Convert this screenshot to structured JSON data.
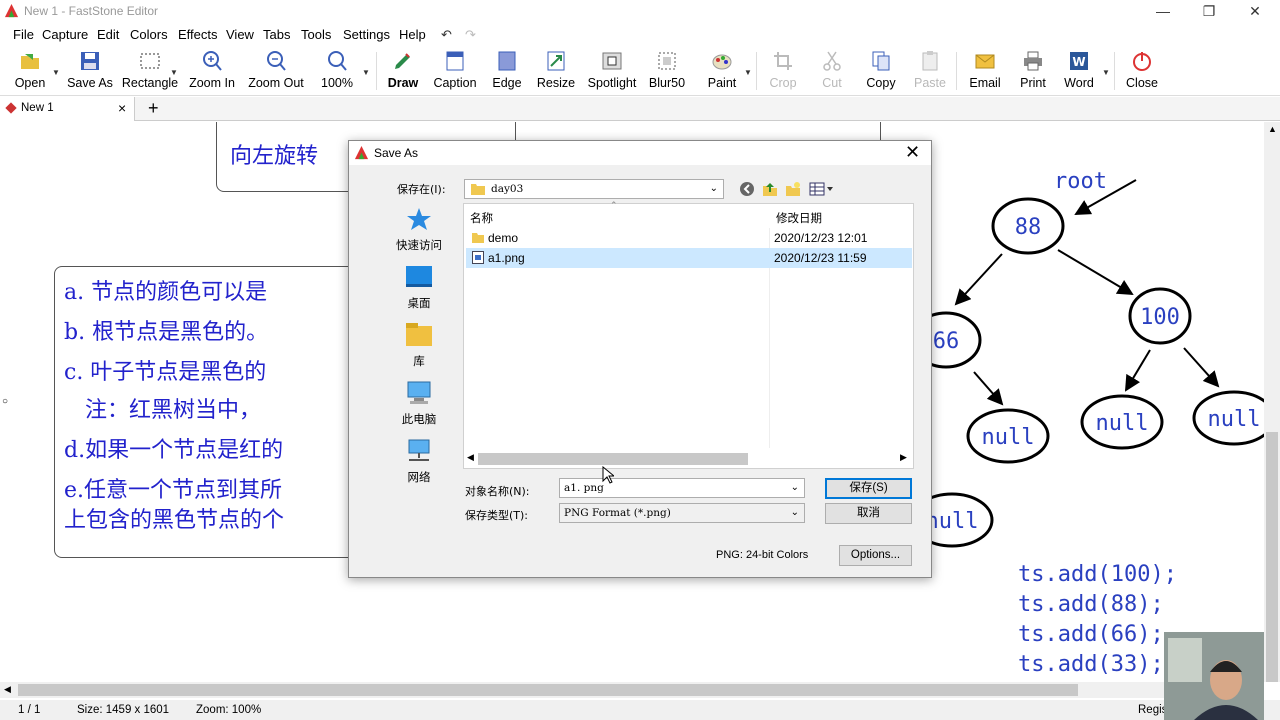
{
  "app": {
    "title": "New 1 - FastStone Editor"
  },
  "menu": [
    "File",
    "Capture",
    "Edit",
    "Colors",
    "Effects",
    "View",
    "Tabs",
    "Tools",
    "Settings",
    "Help"
  ],
  "toolbar": {
    "open": "Open",
    "save_as": "Save As",
    "rectangle": "Rectangle",
    "zoom_in": "Zoom In",
    "zoom_out": "Zoom Out",
    "zoom_level": "100%",
    "draw": "Draw",
    "caption": "Caption",
    "edge": "Edge",
    "resize": "Resize",
    "spotlight": "Spotlight",
    "blur": "Blur50",
    "paint": "Paint",
    "crop": "Crop",
    "cut": "Cut",
    "copy": "Copy",
    "paste": "Paste",
    "email": "Email",
    "print": "Print",
    "word": "Word",
    "close": "Close"
  },
  "tabs": {
    "active": "New 1",
    "close": "×",
    "add": "+"
  },
  "canvas": {
    "rotate_text": "向左旋转",
    "rules": [
      "a. 节点的颜色可以是",
      "b. 根节点是黑色的。",
      "c. 叶子节点是黑色的",
      "   注：红黑树当中，",
      "d.如果一个节点是红的",
      "e.任意一个节点到其所",
      "上包含的黑色节点的个"
    ],
    "tree": {
      "root_label": "root",
      "nodes": [
        "88",
        "100",
        "66",
        "null",
        "null",
        "null",
        "null"
      ]
    },
    "code": [
      "ts.add(100);",
      "ts.add(88);",
      "ts.add(66);",
      "ts.add(33);"
    ]
  },
  "dialog": {
    "title": "Save As",
    "save_in_label": "保存在(I):",
    "folder": "day03",
    "places": [
      "快速访问",
      "桌面",
      "库",
      "此电脑",
      "网络"
    ],
    "columns": {
      "name": "名称",
      "modified": "修改日期"
    },
    "files": [
      {
        "name": "demo",
        "date": "2020/12/23 12:01",
        "type": "folder"
      },
      {
        "name": "a1.png",
        "date": "2020/12/23 11:59",
        "type": "png"
      }
    ],
    "filename_label": "对象名称(N):",
    "filename_value": "a1. png",
    "filetype_label": "保存类型(T):",
    "filetype_value": "PNG Format (*.png)",
    "save_button": "保存(S)",
    "cancel_button": "取消",
    "format_info": "PNG: 24-bit Colors",
    "options_button": "Options..."
  },
  "status": {
    "page": "1 / 1",
    "size": "Size: 1459 x 1601",
    "zoom": "Zoom: 100%",
    "right": "Regis"
  }
}
